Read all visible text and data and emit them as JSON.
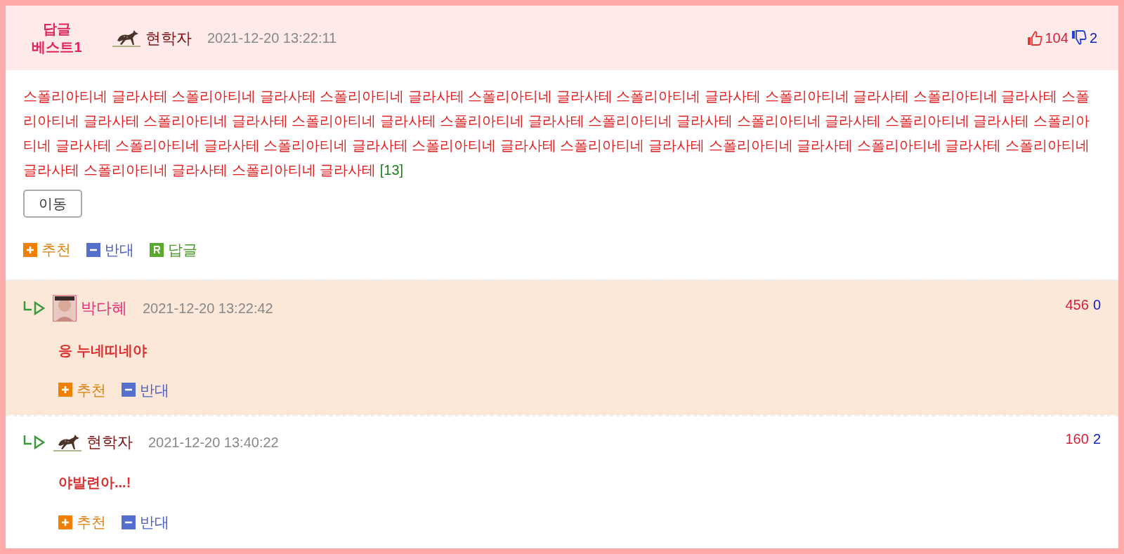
{
  "best_comment": {
    "badge": "답글\n베스트1",
    "author": "현학자",
    "time": "2021-12-20 13:22:11",
    "likes": "104",
    "dislikes": "2",
    "body": "스폴리아티네 글라사테 스폴리아티네 글라사테 스폴리아티네 글라사테 스폴리아티네 글라사테 스폴리아티네 글라사테 스폴리아티네 글라사테 스폴리아티네 글라사테 스폴리아티네 글라사테 스폴리아티네 글라사테 스폴리아티네 글라사테 스폴리아티네 글라사테 스폴리아티네 글라사테 스폴리아티네 글라사테 스폴리아티네 글라사테 스폴리아티네 글라사테 스폴리아티네 글라사테 스폴리아티네 글라사테 스폴리아티네 글라사테 스폴리아티네 글라사테 스폴리아티네 글라사테 스폴리아티네 글라사테 스폴리아티네 글라사테 스폴리아티네 글라사테 스폴리아티네 글라사테",
    "reply_count": "[13]",
    "move_button": "이동",
    "actions": [
      {
        "kind": "up",
        "label": "추천"
      },
      {
        "kind": "down",
        "label": "반대"
      },
      {
        "kind": "reply",
        "label": "답글"
      }
    ]
  },
  "replies": [
    {
      "kind": "photo",
      "author": "박다혜",
      "time": "2021-12-20 13:22:42",
      "likes": "456",
      "dislikes": "0",
      "body": "응 누네띠네야",
      "highlighted": true,
      "actions": [
        {
          "kind": "up",
          "label": "추천"
        },
        {
          "kind": "down",
          "label": "반대"
        }
      ]
    },
    {
      "kind": "deer",
      "author": "현학자",
      "time": "2021-12-20 13:40:22",
      "likes": "160",
      "dislikes": "2",
      "body": "야발련아...!",
      "highlighted": false,
      "actions": [
        {
          "kind": "up",
          "label": "추천"
        },
        {
          "kind": "down",
          "label": "반대"
        }
      ]
    }
  ]
}
